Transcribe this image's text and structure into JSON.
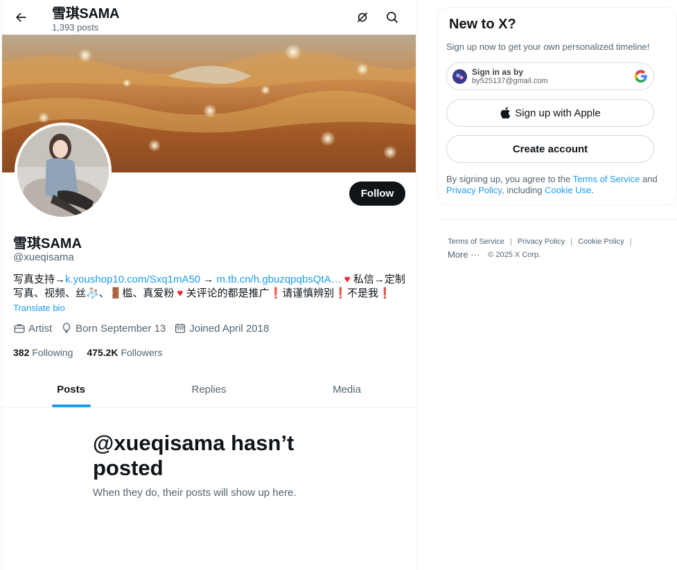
{
  "header": {
    "name": "雪琪SAMA",
    "posts_count": "1,393 posts"
  },
  "profile": {
    "display_name": "雪琪SAMA",
    "handle": "@xueqisama",
    "follow_label": "Follow",
    "bio": {
      "prefix": "写真支持→",
      "link1": "k.youshop10.com/Sxq1mA50",
      "arrow": " → ",
      "link2": "m.tb.cn/h.gbuzqpqbsQtA…",
      "heart": " ♥ ",
      "mid": "私信→定制",
      "line2a": "写真、视频、丝🧦、🚪槛、真爱粉 ",
      "heart2": "♥",
      "line2b": " 关评论的都是推广❗请谨慎辨别❗不是我❗"
    },
    "translate_label": "Translate bio",
    "meta": {
      "category": "Artist",
      "birthday": "Born September 13",
      "joined": "Joined April 2018"
    },
    "stats": {
      "following_count": "382",
      "following_label": "Following",
      "followers_count": "475.2K",
      "followers_label": "Followers"
    }
  },
  "tabs": [
    {
      "label": "Posts",
      "active": true
    },
    {
      "label": "Replies",
      "active": false
    },
    {
      "label": "Media",
      "active": false
    }
  ],
  "empty_state": {
    "title": "@xueqisama hasn’t posted",
    "subtitle": "When they do, their posts will show up here."
  },
  "signup": {
    "title": "New to X?",
    "subtitle": "Sign up now to get your own personalized timeline!",
    "google_line1": "Sign in as by",
    "google_line2": "by525137@gmail.com",
    "apple_label": "Sign up with Apple",
    "create_label": "Create account",
    "terms_prefix": "By signing up, you agree to the ",
    "terms_link": "Terms of Service",
    "terms_and": " and ",
    "privacy_link": "Privacy Policy",
    "terms_including": ", including ",
    "cookie_link": "Cookie Use",
    "terms_end": "."
  },
  "footer": {
    "terms": "Terms of Service",
    "privacy": "Privacy Policy",
    "cookie": "Cookie Policy",
    "more": "More ···",
    "copyright": "© 2025 X Corp."
  },
  "colors": {
    "accent": "#1d9bf0",
    "text": "#0f1419",
    "muted": "#536471",
    "border": "#eff3f4",
    "heart": "#f4212e"
  },
  "icons": [
    "back-arrow-icon",
    "grok-icon",
    "search-icon",
    "briefcase-icon",
    "balloon-icon",
    "calendar-icon",
    "google-logo-icon",
    "apple-logo-icon"
  ]
}
